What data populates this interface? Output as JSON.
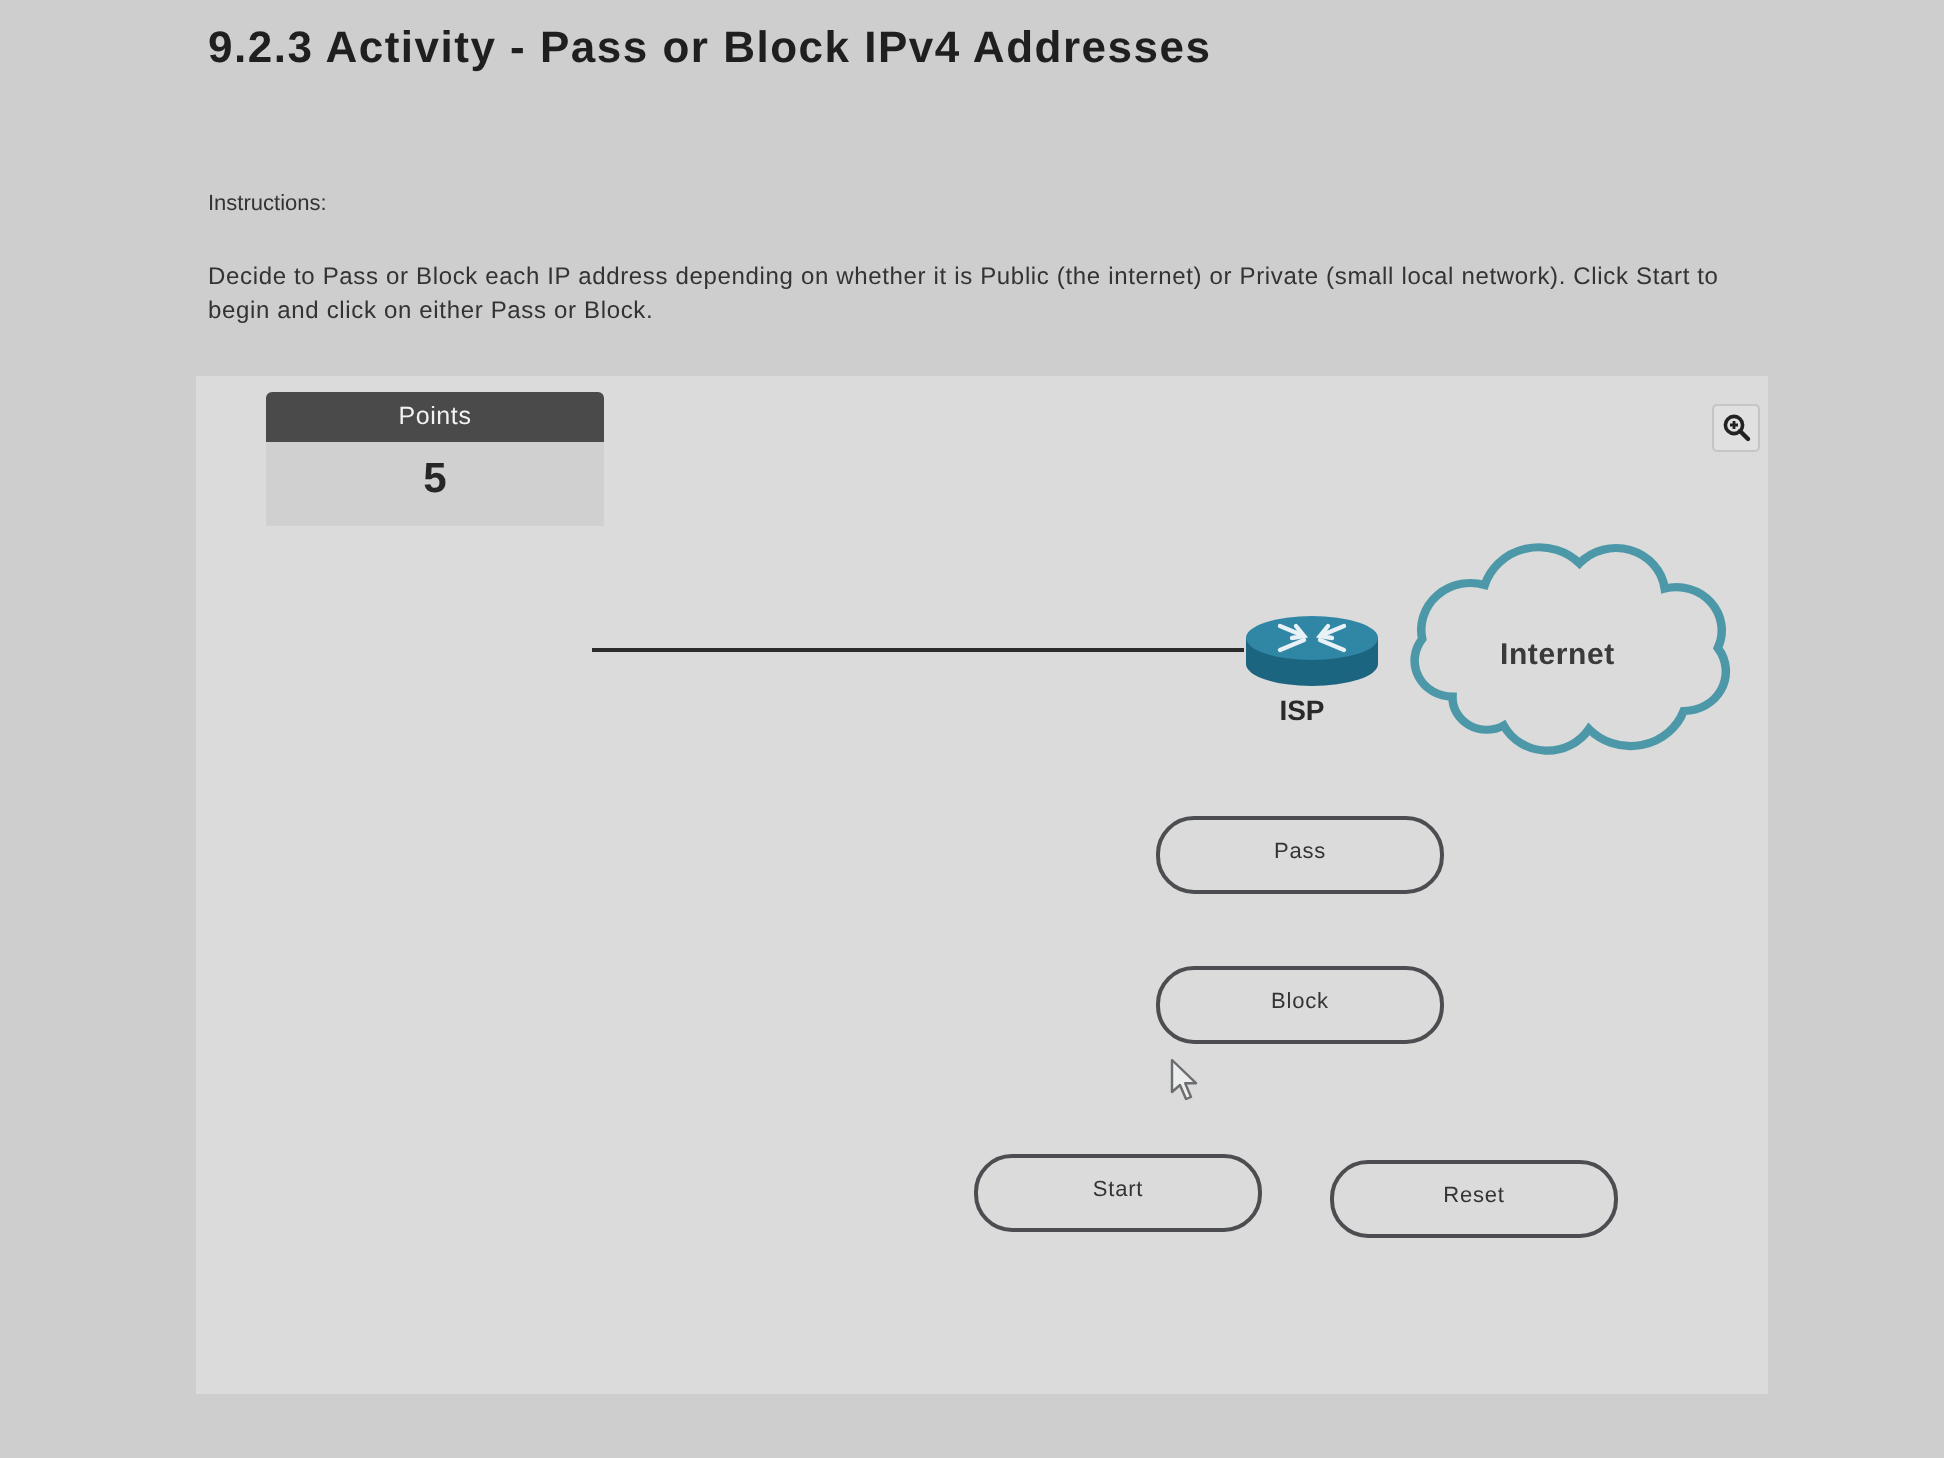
{
  "title": "9.2.3 Activity - Pass or Block IPv4 Addresses",
  "instructions": {
    "label": "Instructions:",
    "text": "Decide to Pass or Block each IP address depending on whether it is Public (the internet) or Private (small local network). Click Start to begin and click on either Pass or Block."
  },
  "activity": {
    "points": {
      "label": "Points",
      "value": "5"
    },
    "diagram": {
      "router": {
        "label": "ISP"
      },
      "cloud": {
        "label": "Internet"
      }
    },
    "answer_buttons": [
      "Pass",
      "Block"
    ],
    "control_buttons": [
      "Start",
      "Reset"
    ]
  }
}
